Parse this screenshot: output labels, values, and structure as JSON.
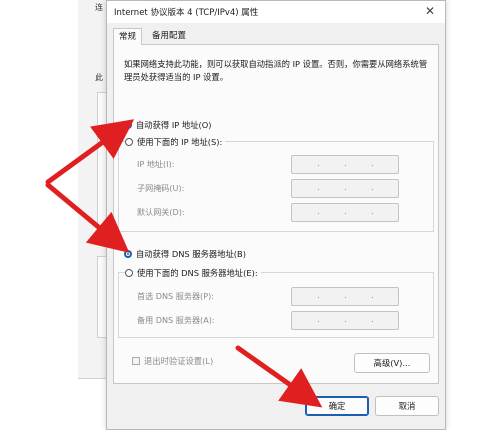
{
  "background_window": {
    "labels": [
      "连",
      "此"
    ]
  },
  "dialog": {
    "title": "Internet 协议版本 4 (TCP/IPv4) 属性",
    "close_glyph": "✕",
    "tabs": [
      {
        "label": "常规",
        "active": true
      },
      {
        "label": "备用配置",
        "active": false
      }
    ],
    "description": "如果网络支持此功能，则可以获取自动指派的 IP 设置。否则，你需要从网络系统管理员处获得适当的 IP 设置。",
    "ip_section": {
      "auto_label": "自动获得 IP 地址(O)",
      "auto_selected": true,
      "manual_label": "使用下面的 IP 地址(S):",
      "manual_selected": false,
      "fields": [
        {
          "label": "IP 地址(I):",
          "value": ".   .   ."
        },
        {
          "label": "子网掩码(U):",
          "value": ".   .   ."
        },
        {
          "label": "默认网关(D):",
          "value": ".   .   ."
        }
      ]
    },
    "dns_section": {
      "auto_label": "自动获得 DNS 服务器地址(B)",
      "auto_selected": true,
      "manual_label": "使用下面的 DNS 服务器地址(E):",
      "manual_selected": false,
      "fields": [
        {
          "label": "首选 DNS 服务器(P):",
          "value": ".   .   ."
        },
        {
          "label": "备用 DNS 服务器(A):",
          "value": ".   .   ."
        }
      ]
    },
    "validate_checkbox": {
      "label": "退出时验证设置(L)",
      "checked": false
    },
    "advanced_button": "高级(V)...",
    "ok_button": "确定",
    "cancel_button": "取消"
  },
  "colors": {
    "accent": "#1a5fb4",
    "annotation_arrow": "#e02020",
    "dialog_bg": "#f0f0f0"
  },
  "annotations": {
    "arrow_icon": "red-arrow-icon",
    "count": 3
  }
}
